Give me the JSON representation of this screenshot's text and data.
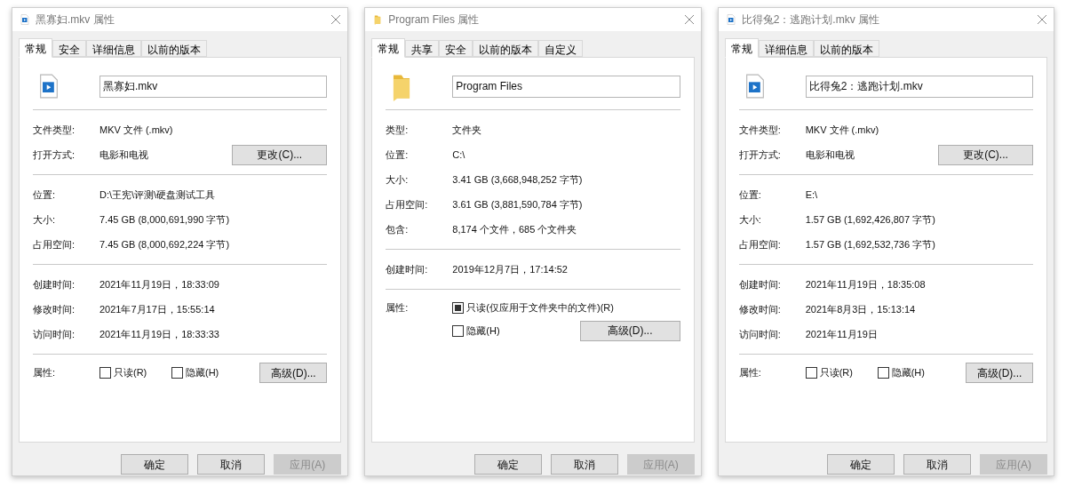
{
  "dialogs": [
    {
      "title": "黑寡妇.mkv 属性",
      "kind": "video",
      "tabs": [
        {
          "label": "常规",
          "selected": true
        },
        {
          "label": "安全",
          "selected": false
        },
        {
          "label": "详细信息",
          "selected": false
        },
        {
          "label": "以前的版本",
          "selected": false
        }
      ],
      "name": "黑寡妇.mkv",
      "sections": [
        [
          {
            "label": "文件类型:",
            "value": "MKV 文件 (.mkv)"
          },
          {
            "label": "打开方式:",
            "value": "电影和电视",
            "button": "更改(C)..."
          }
        ],
        [
          {
            "label": "位置:",
            "value": "D:\\王宪\\评测\\硬盘测试工具"
          },
          {
            "label": "大小:",
            "value": "7.45 GB (8,000,691,990 字节)"
          },
          {
            "label": "占用空间:",
            "value": "7.45 GB (8,000,692,224 字节)"
          }
        ],
        [
          {
            "label": "创建时间:",
            "value": "2021年11月19日，18:33:09"
          },
          {
            "label": "修改时间:",
            "value": "2021年7月17日，15:55:14"
          },
          {
            "label": "访问时间:",
            "value": "2021年11月19日，18:33:33"
          }
        ]
      ],
      "attributes": {
        "label": "属性:",
        "kind": "row",
        "checkboxes": [
          {
            "label": "只读(R)",
            "checked": false
          },
          {
            "label": "隐藏(H)",
            "checked": false
          }
        ],
        "button": "高级(D)..."
      },
      "buttons": [
        {
          "label": "确定",
          "disabled": false
        },
        {
          "label": "取消",
          "disabled": false
        },
        {
          "label": "应用(A)",
          "disabled": true
        }
      ]
    },
    {
      "title": "Program Files 属性",
      "kind": "folder",
      "tabs": [
        {
          "label": "常规",
          "selected": true
        },
        {
          "label": "共享",
          "selected": false
        },
        {
          "label": "安全",
          "selected": false
        },
        {
          "label": "以前的版本",
          "selected": false
        },
        {
          "label": "自定义",
          "selected": false
        }
      ],
      "name": "Program Files",
      "sections": [
        [
          {
            "label": "类型:",
            "value": "文件夹"
          },
          {
            "label": "位置:",
            "value": "C:\\"
          },
          {
            "label": "大小:",
            "value": "3.41 GB (3,668,948,252 字节)"
          },
          {
            "label": "占用空间:",
            "value": "3.61 GB (3,881,590,784 字节)"
          },
          {
            "label": "包含:",
            "value": "8,174 个文件，685 个文件夹"
          }
        ],
        [
          {
            "label": "创建时间:",
            "value": "2019年12月7日，17:14:52"
          }
        ]
      ],
      "attributes": {
        "label": "属性:",
        "kind": "stacked",
        "checkboxes": [
          {
            "label": "只读(仅应用于文件夹中的文件)(R)",
            "checked": true
          },
          {
            "label": "隐藏(H)",
            "checked": false
          }
        ],
        "button": "高级(D)..."
      },
      "buttons": [
        {
          "label": "确定",
          "disabled": false
        },
        {
          "label": "取消",
          "disabled": false
        },
        {
          "label": "应用(A)",
          "disabled": true
        }
      ]
    },
    {
      "title": "比得兔2：逃跑计划.mkv 属性",
      "kind": "video",
      "tabs": [
        {
          "label": "常规",
          "selected": true
        },
        {
          "label": "详细信息",
          "selected": false
        },
        {
          "label": "以前的版本",
          "selected": false
        }
      ],
      "name": "比得兔2：逃跑计划.mkv",
      "sections": [
        [
          {
            "label": "文件类型:",
            "value": "MKV 文件 (.mkv)"
          },
          {
            "label": "打开方式:",
            "value": "电影和电视",
            "button": "更改(C)..."
          }
        ],
        [
          {
            "label": "位置:",
            "value": "E:\\"
          },
          {
            "label": "大小:",
            "value": "1.57 GB (1,692,426,807 字节)"
          },
          {
            "label": "占用空间:",
            "value": "1.57 GB (1,692,532,736 字节)"
          }
        ],
        [
          {
            "label": "创建时间:",
            "value": "2021年11月19日，18:35:08"
          },
          {
            "label": "修改时间:",
            "value": "2021年8月3日，15:13:14"
          },
          {
            "label": "访问时间:",
            "value": "2021年11月19日"
          }
        ]
      ],
      "attributes": {
        "label": "属性:",
        "kind": "row",
        "checkboxes": [
          {
            "label": "只读(R)",
            "checked": false
          },
          {
            "label": "隐藏(H)",
            "checked": false
          }
        ],
        "button": "高级(D)..."
      },
      "buttons": [
        {
          "label": "确定",
          "disabled": false
        },
        {
          "label": "取消",
          "disabled": false
        },
        {
          "label": "应用(A)",
          "disabled": true
        }
      ]
    }
  ]
}
